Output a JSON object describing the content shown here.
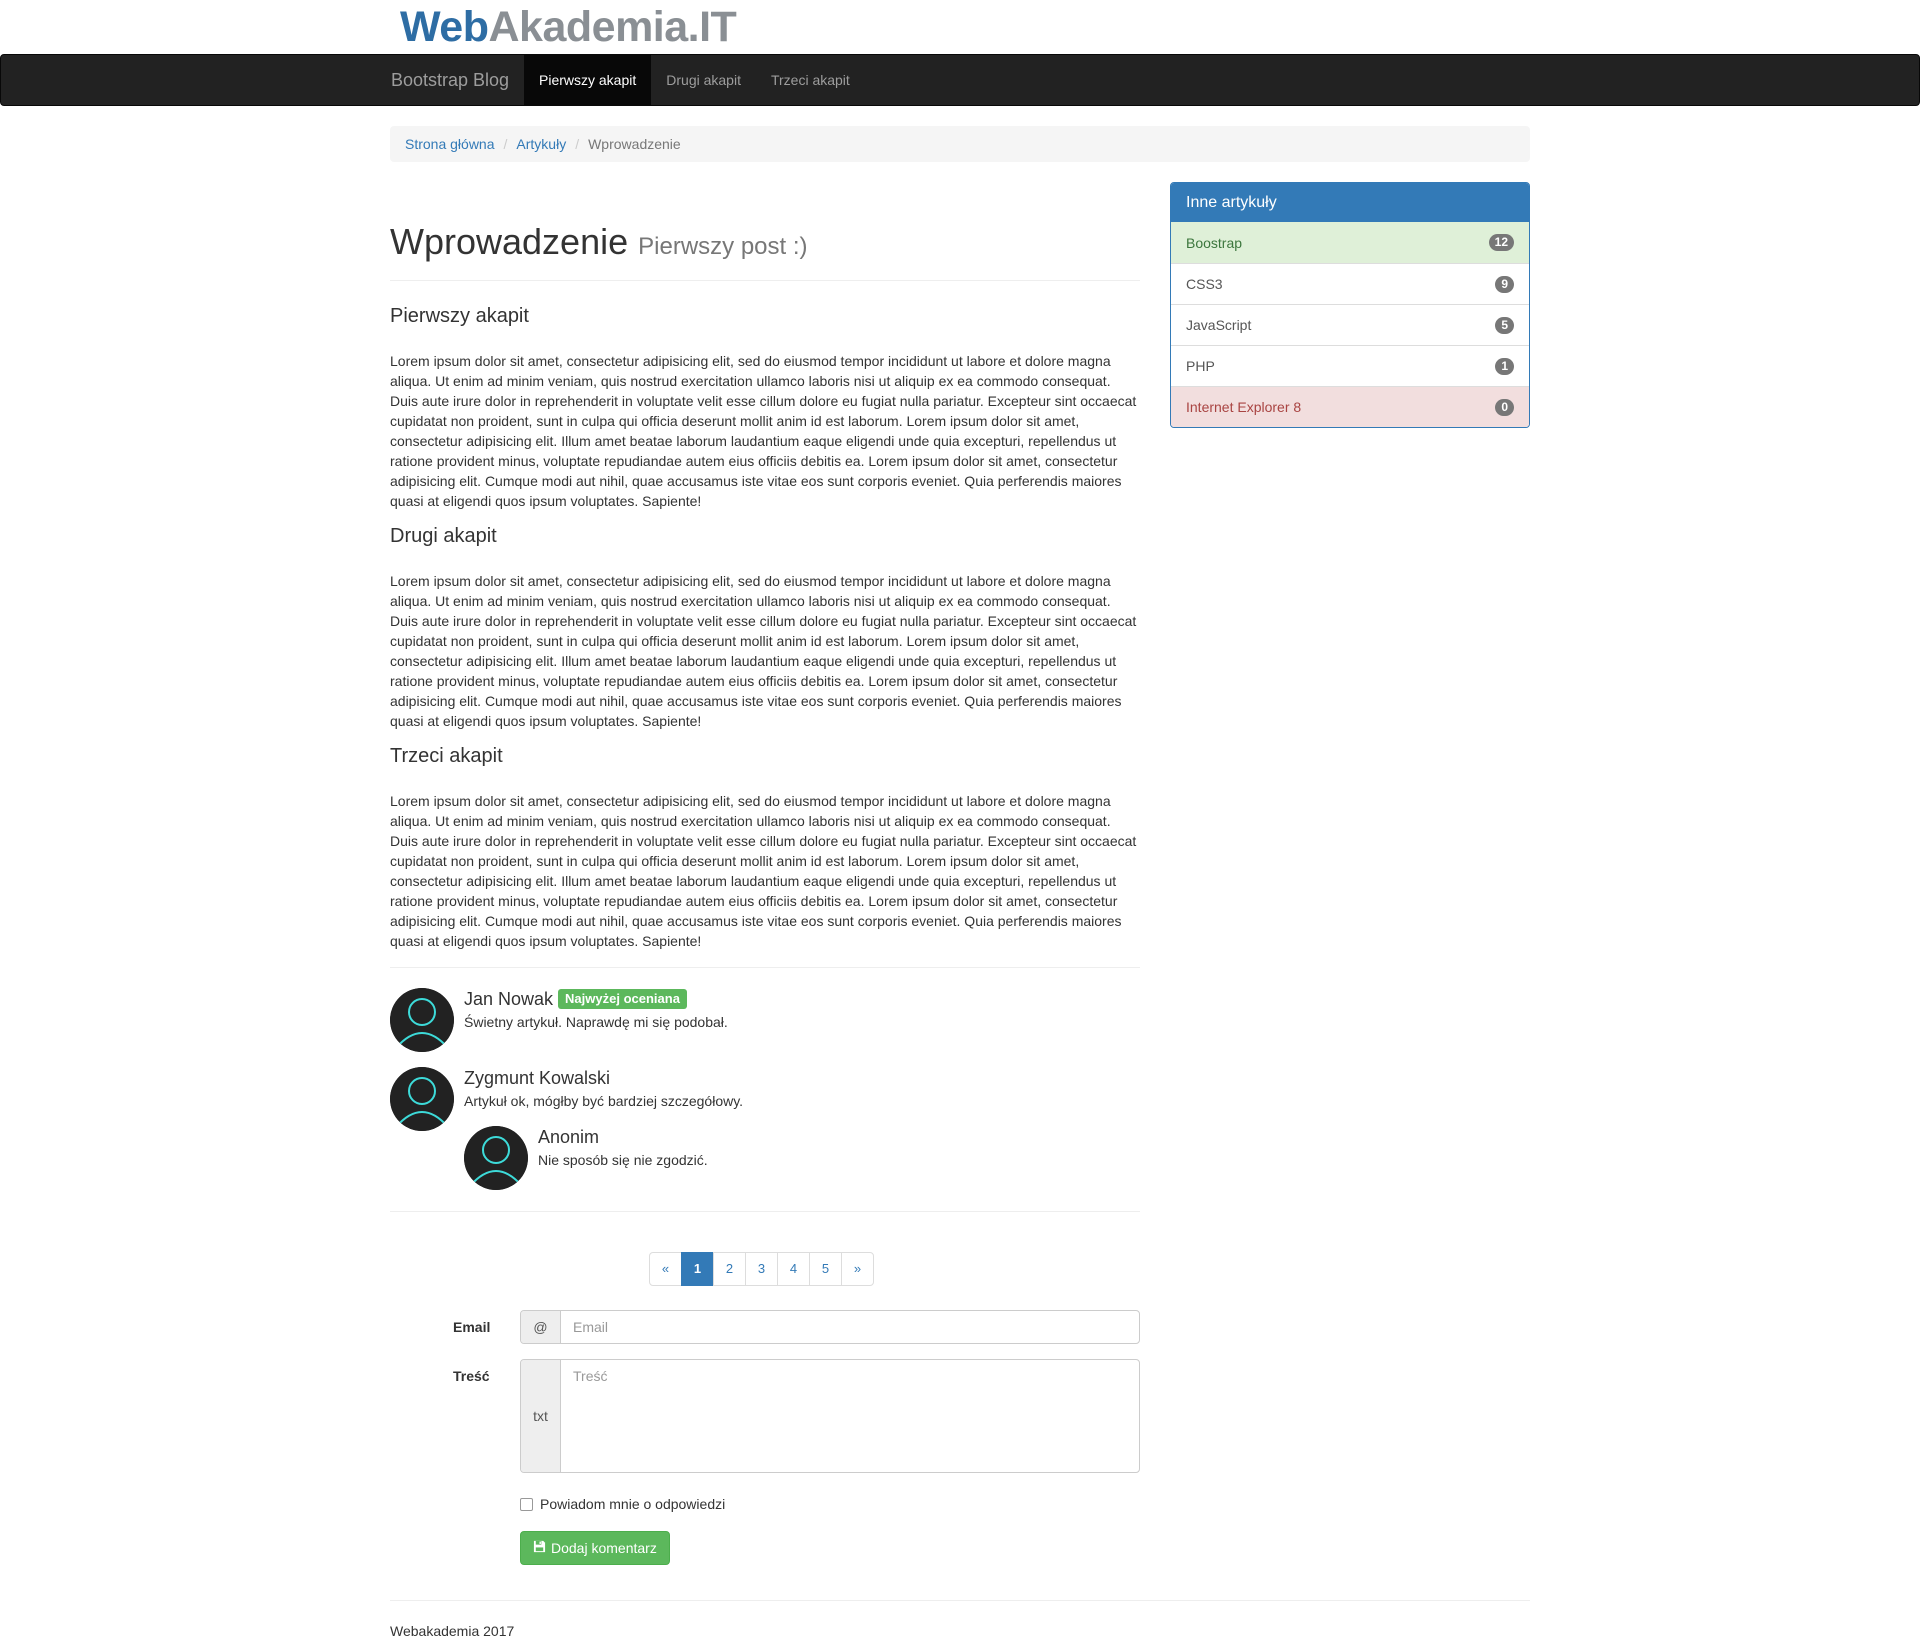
{
  "logo": {
    "part1": "Web",
    "part2": "Akademia.IT"
  },
  "navbar": {
    "brand": "Bootstrap Blog",
    "items": [
      {
        "label": "Pierwszy akapit",
        "active": true
      },
      {
        "label": "Drugi akapit",
        "active": false
      },
      {
        "label": "Trzeci akapit",
        "active": false
      }
    ]
  },
  "breadcrumb": {
    "items": [
      "Strona główna",
      "Artykuły"
    ],
    "separator": "/",
    "current": "Wprowadzenie"
  },
  "post": {
    "title": "Wprowadzenie",
    "subtitle": "Pierwszy post :)",
    "sections": [
      {
        "heading": "Pierwszy akapit",
        "body": "Lorem ipsum dolor sit amet, consectetur adipisicing elit, sed do eiusmod tempor incididunt ut labore et dolore magna aliqua. Ut enim ad minim veniam, quis nostrud exercitation ullamco laboris nisi ut aliquip ex ea commodo consequat. Duis aute irure dolor in reprehenderit in voluptate velit esse cillum dolore eu fugiat nulla pariatur. Excepteur sint occaecat cupidatat non proident, sunt in culpa qui officia deserunt mollit anim id est laborum. Lorem ipsum dolor sit amet, consectetur adipisicing elit. Illum amet beatae laborum laudantium eaque eligendi unde quia excepturi, repellendus ut ratione provident minus, voluptate repudiandae autem eius officiis debitis ea. Lorem ipsum dolor sit amet, consectetur adipisicing elit. Cumque modi aut nihil, quae accusamus iste vitae eos sunt corporis eveniet. Quia perferendis maiores quasi at eligendi quos ipsum voluptates. Sapiente!"
      },
      {
        "heading": "Drugi akapit",
        "body": "Lorem ipsum dolor sit amet, consectetur adipisicing elit, sed do eiusmod tempor incididunt ut labore et dolore magna aliqua. Ut enim ad minim veniam, quis nostrud exercitation ullamco laboris nisi ut aliquip ex ea commodo consequat. Duis aute irure dolor in reprehenderit in voluptate velit esse cillum dolore eu fugiat nulla pariatur. Excepteur sint occaecat cupidatat non proident, sunt in culpa qui officia deserunt mollit anim id est laborum. Lorem ipsum dolor sit amet, consectetur adipisicing elit. Illum amet beatae laborum laudantium eaque eligendi unde quia excepturi, repellendus ut ratione provident minus, voluptate repudiandae autem eius officiis debitis ea. Lorem ipsum dolor sit amet, consectetur adipisicing elit. Cumque modi aut nihil, quae accusamus iste vitae eos sunt corporis eveniet. Quia perferendis maiores quasi at eligendi quos ipsum voluptates. Sapiente!"
      },
      {
        "heading": "Trzeci akapit",
        "body": "Lorem ipsum dolor sit amet, consectetur adipisicing elit, sed do eiusmod tempor incididunt ut labore et dolore magna aliqua. Ut enim ad minim veniam, quis nostrud exercitation ullamco laboris nisi ut aliquip ex ea commodo consequat. Duis aute irure dolor in reprehenderit in voluptate velit esse cillum dolore eu fugiat nulla pariatur. Excepteur sint occaecat cupidatat non proident, sunt in culpa qui officia deserunt mollit anim id est laborum. Lorem ipsum dolor sit amet, consectetur adipisicing elit. Illum amet beatae laborum laudantium eaque eligendi unde quia excepturi, repellendus ut ratione provident minus, voluptate repudiandae autem eius officiis debitis ea. Lorem ipsum dolor sit amet, consectetur adipisicing elit. Cumque modi aut nihil, quae accusamus iste vitae eos sunt corporis eveniet. Quia perferendis maiores quasi at eligendi quos ipsum voluptates. Sapiente!"
      }
    ]
  },
  "comments": [
    {
      "author": "Jan Nowak",
      "badge": "Najwyżej oceniana",
      "text": "Świetny artykuł. Naprawdę mi się podobał."
    },
    {
      "author": "Zygmunt Kowalski",
      "text": "Artykuł ok, mógłby być bardziej szczegółowy."
    },
    {
      "author": "Anonim",
      "text": "Nie sposób się nie zgodzić."
    }
  ],
  "pagination": {
    "prev": "«",
    "pages": [
      "1",
      "2",
      "3",
      "4",
      "5"
    ],
    "active": "1",
    "next": "»"
  },
  "form": {
    "email_label": "Email",
    "email_addon": "@",
    "email_placeholder": "Email",
    "content_label": "Treść",
    "content_addon": "txt",
    "content_placeholder": "Treść",
    "checkbox_label": "Powiadom mnie o odpowiedzi",
    "checkbox_checked": false,
    "submit_label": "Dodaj komentarz",
    "submit_icon": "floppy-disk-icon"
  },
  "footer": {
    "text": "Webakademia 2017"
  },
  "sidebar": {
    "title": "Inne artykuły",
    "items": [
      {
        "label": "Boostrap",
        "count": "12",
        "state": "success"
      },
      {
        "label": "CSS3",
        "count": "9",
        "state": "default"
      },
      {
        "label": "JavaScript",
        "count": "5",
        "state": "default"
      },
      {
        "label": "PHP",
        "count": "1",
        "state": "default"
      },
      {
        "label": "Internet Explorer 8",
        "count": "0",
        "state": "danger"
      }
    ]
  },
  "colors": {
    "primary": "#337ab7",
    "navbar_bg": "#222222",
    "success": "#5cb85c",
    "success_bg": "#dff0d8",
    "danger_bg": "#f2dede",
    "avatar_ring": "#3ddbd9"
  }
}
